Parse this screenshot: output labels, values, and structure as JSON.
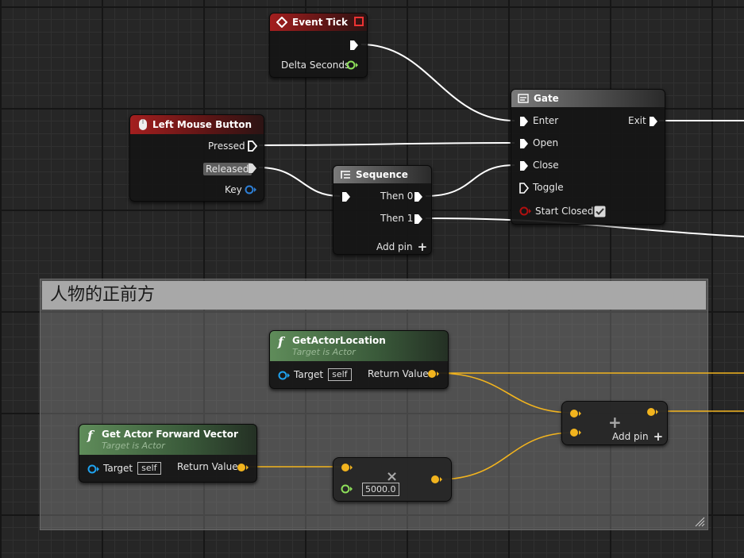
{
  "comment": {
    "title": "人物的正前方"
  },
  "nodes": {
    "event_tick": {
      "title": "Event Tick",
      "delta": "Delta Seconds"
    },
    "lmb": {
      "title": "Left Mouse Button",
      "pressed": "Pressed",
      "released": "Released",
      "key": "Key"
    },
    "sequence": {
      "title": "Sequence",
      "then0": "Then 0",
      "then1": "Then 1",
      "add_pin": "Add pin"
    },
    "gate": {
      "title": "Gate",
      "enter": "Enter",
      "exit": "Exit",
      "open": "Open",
      "close": "Close",
      "toggle": "Toggle",
      "start_closed": "Start Closed"
    },
    "get_location": {
      "title": "GetActorLocation",
      "subtitle": "Target is Actor",
      "target": "Target",
      "self": "self",
      "return": "Return Value"
    },
    "get_forward": {
      "title": "Get Actor Forward Vector",
      "subtitle": "Target is Actor",
      "target": "Target",
      "self": "self",
      "return": "Return Value"
    },
    "multiply": {
      "symbol": "×",
      "value": "5000.0"
    },
    "add": {
      "symbol": "+",
      "add_pin": "Add pin"
    }
  },
  "colors": {
    "exec_wire": "#ffffff",
    "vector_wire": "#f2b41e",
    "float_pin": "#8ee05a",
    "object_pin": "#1fa3f0",
    "struct_pin": "#2d7fd6",
    "bool_pin": "#9b0a0a",
    "event_header": "#a41f1f",
    "func_header": "#5f8c5a"
  }
}
